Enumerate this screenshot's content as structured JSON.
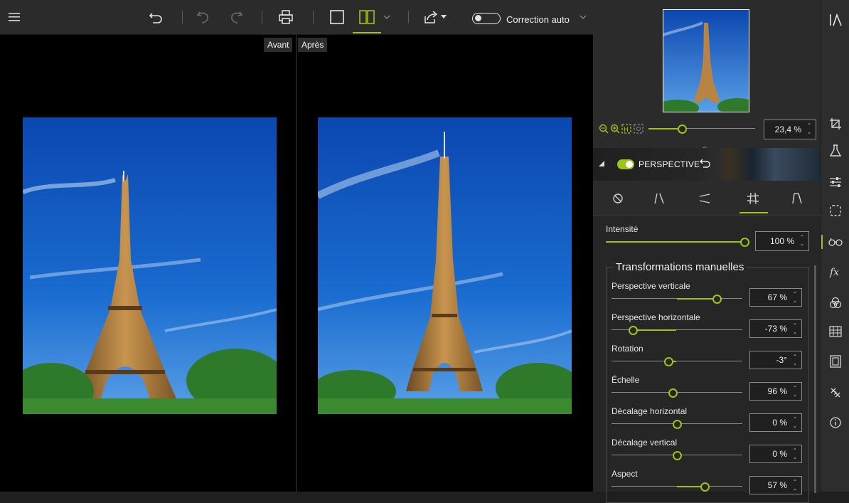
{
  "toolbar": {
    "icons": [
      "menu-icon",
      "undo-all-icon",
      "undo-icon",
      "redo-icon",
      "print-icon",
      "single-view-icon",
      "split-view-icon",
      "chevron-down-icon",
      "share-icon",
      "chevron-down-icon"
    ],
    "auto_correction_label": "Correction auto"
  },
  "viewer": {
    "before_label": "Avant",
    "after_label": "Après"
  },
  "zoom": {
    "value": "23,4 %",
    "level": 0.3
  },
  "perspective": {
    "title": "PERSPECTIVE",
    "enabled": true
  },
  "tools": [
    "cancel-icon",
    "vertical-perspective-icon",
    "horizontal-perspective-icon",
    "grid-perspective-icon",
    "auto-perspective-icon"
  ],
  "intensity": {
    "label": "Intensité",
    "value": "100 %",
    "level": 1.0
  },
  "manual": {
    "title": "Transformations manuelles",
    "items": [
      {
        "label": "Perspective verticale",
        "value": "67 %",
        "level": 0.83
      },
      {
        "label": "Perspective horizontale",
        "value": "-73 %",
        "level": 0.14
      },
      {
        "label": "Rotation",
        "value": "-3°",
        "level": 0.43
      },
      {
        "label": "Échelle",
        "value": "96 %",
        "level": 0.47
      },
      {
        "label": "Décalage horizontal",
        "value": "0 %",
        "level": 0.5
      },
      {
        "label": "Décalage vertical",
        "value": "0 %",
        "level": 0.5
      },
      {
        "label": "Aspect",
        "value": "57 %",
        "level": 0.73
      }
    ]
  },
  "rail_icons": [
    "logo-icon",
    "crop-icon",
    "flask-icon",
    "adjust-icon",
    "selection-icon",
    "glasses-icon",
    "fx-icon",
    "color-icon",
    "texture-icon",
    "frame-icon",
    "watermark-icon",
    "info-icon"
  ],
  "colors": {
    "accent": "#9dc41b",
    "sky": "#1a64c8"
  }
}
